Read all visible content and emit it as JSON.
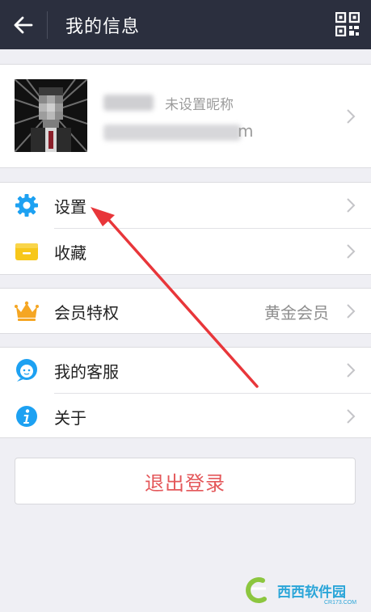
{
  "header": {
    "title": "我的信息",
    "back_icon": "arrow-left-icon",
    "qr_icon": "qr-code-icon"
  },
  "profile": {
    "nickname_hint": "未设置昵称",
    "email_suffix": "m"
  },
  "menu_group1": [
    {
      "label": "设置",
      "icon": "gear-icon"
    },
    {
      "label": "收藏",
      "icon": "folder-icon"
    }
  ],
  "menu_group2": [
    {
      "label": "会员特权",
      "value": "黄金会员",
      "icon": "crown-icon"
    }
  ],
  "menu_group3": [
    {
      "label": "我的客服",
      "icon": "customer-service-icon"
    },
    {
      "label": "关于",
      "icon": "info-icon"
    }
  ],
  "logout_label": "退出登录",
  "watermark": {
    "text": "西西软件园",
    "sub": "CR173.COM"
  },
  "colors": {
    "header_bg": "#2b2f3e",
    "accent_blue": "#1da1f2",
    "logout_red": "#e4575a",
    "crown_orange": "#f5a623",
    "folder_yellow": "#f7c71a",
    "annotation_red": "#e8363a"
  }
}
